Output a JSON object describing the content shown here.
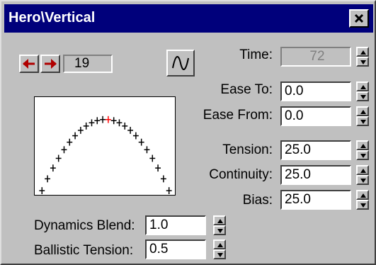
{
  "window": {
    "title": "Hero\\Vertical"
  },
  "key": {
    "prev_icon": "arrow-left-icon",
    "next_icon": "arrow-right-icon",
    "number": "19",
    "tangent_icon": "curve-tangent-icon"
  },
  "params": {
    "time": {
      "label": "Time:",
      "value": "72"
    },
    "ease_to": {
      "label": "Ease To:",
      "value": "0.0"
    },
    "ease_from": {
      "label": "Ease From:",
      "value": "0.0"
    },
    "tension": {
      "label": "Tension:",
      "value": "25.0"
    },
    "continuity": {
      "label": "Continuity:",
      "value": "25.0"
    },
    "bias": {
      "label": "Bias:",
      "value": "25.0"
    }
  },
  "dynamics": {
    "blend_label": "Dynamics Blend:",
    "blend_value": "1.0",
    "ballistic_label": "Ballistic Tension:",
    "ballistic_value": "0.5"
  },
  "colors": {
    "titlebar": "#00007b",
    "arrow": "#b00000",
    "highlight_tick": "#ff0000"
  }
}
